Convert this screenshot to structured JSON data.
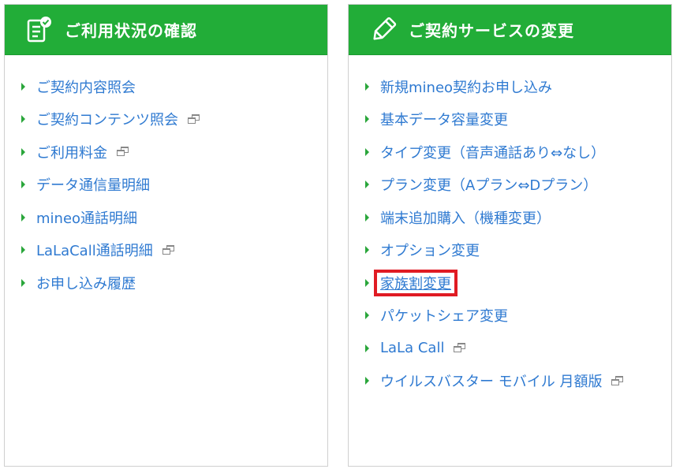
{
  "left_panel": {
    "title": "ご利用状況の確認",
    "icon": "clipboard-check-icon",
    "items": [
      {
        "label": "ご契約内容照会",
        "external": false
      },
      {
        "label": "ご契約コンテンツ照会",
        "external": true
      },
      {
        "label": "ご利用料金",
        "external": true
      },
      {
        "label": "データ通信量明細",
        "external": false
      },
      {
        "label": "mineo通話明細",
        "external": false
      },
      {
        "label": "LaLaCall通話明細",
        "external": true
      },
      {
        "label": "お申し込み履歴",
        "external": false
      }
    ]
  },
  "right_panel": {
    "title": "ご契約サービスの変更",
    "icon": "pencil-edit-icon",
    "items": [
      {
        "label": "新規mineo契約お申し込み",
        "external": false
      },
      {
        "label": "基本データ容量変更",
        "external": false
      },
      {
        "label": "タイプ変更（音声通話あり⇔なし）",
        "external": false
      },
      {
        "label": "プラン変更（Aプラン⇔Dプラン）",
        "external": false
      },
      {
        "label": "端末追加購入（機種変更）",
        "external": false
      },
      {
        "label": "オプション変更",
        "external": false
      },
      {
        "label": "家族割変更",
        "external": false,
        "highlighted": true
      },
      {
        "label": "パケットシェア変更",
        "external": false
      },
      {
        "label": "LaLa Call",
        "external": true
      },
      {
        "label": "ウイルスバスター モバイル 月額版",
        "external": true
      }
    ]
  },
  "colors": {
    "header_bg": "#22ad38",
    "link": "#2f7ad1",
    "bullet": "#2aa63b",
    "highlight_border": "#e01b23"
  }
}
